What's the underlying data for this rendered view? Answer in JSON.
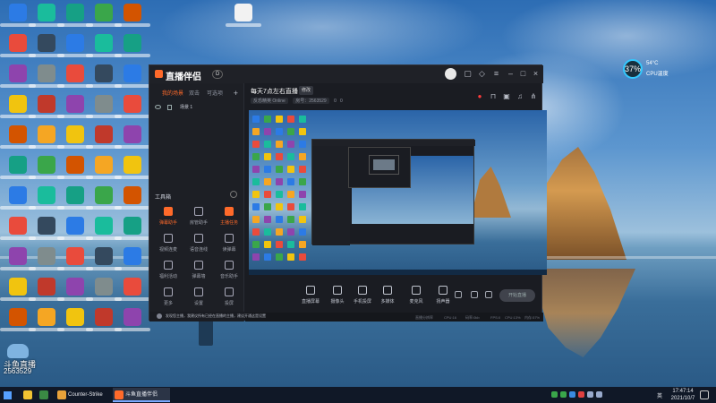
{
  "app": {
    "logo_text": "直播伴侣",
    "version_badge": "D",
    "sidebar_tabs": [
      "我的场景",
      "双击",
      "可选项"
    ],
    "scene_name": "场景 1",
    "tools_title": "工具箱",
    "tools": [
      {
        "label": "弹幕助手",
        "icon": "danmaku-icon",
        "hot": true
      },
      {
        "label": "房管助手",
        "icon": "admin-icon",
        "hot": false
      },
      {
        "label": "主播任务",
        "icon": "task-icon",
        "hot": true
      },
      {
        "label": "视频连麦",
        "icon": "video-call-icon",
        "hot": false
      },
      {
        "label": "语音连线",
        "icon": "voice-icon",
        "hot": false
      },
      {
        "label": "读弹幕",
        "icon": "read-danmaku-icon",
        "hot": false
      },
      {
        "label": "福利活动",
        "icon": "gift-icon",
        "hot": false
      },
      {
        "label": "弹幕墙",
        "icon": "wall-icon",
        "hot": false
      },
      {
        "label": "音乐助手",
        "icon": "music-icon",
        "hot": false
      },
      {
        "label": "更多",
        "icon": "more-icon",
        "hot": false
      },
      {
        "label": "设置",
        "icon": "settings-icon",
        "hot": false
      },
      {
        "label": "投屏",
        "icon": "cast-icon",
        "hot": false
      }
    ],
    "room_title": "每天7点左右直播",
    "room_tag": "修改",
    "room_meta": [
      "反恐精英 Online",
      "房号：2563529"
    ],
    "room_counts": [
      "0",
      "0"
    ],
    "controls": [
      {
        "label": "直播屏幕",
        "icon": "screen-icon"
      },
      {
        "label": "摄像头",
        "icon": "camera-icon"
      },
      {
        "label": "手机投屏",
        "icon": "phone-cast-icon"
      },
      {
        "label": "多媒体",
        "icon": "media-icon"
      },
      {
        "label": "麦克风",
        "icon": "mic-icon"
      },
      {
        "label": "扬声器",
        "icon": "speaker-icon"
      }
    ],
    "go_live_label": "开始直播",
    "notice_text": "发现您主播，我建议所有已经在直播的主播，建议开通这是设置",
    "status_items": [
      "直播分辨率",
      "CPU:16",
      "码率:0kb",
      "FPS:0",
      "CPU:13%",
      "内存:57%"
    ]
  },
  "desktop": {
    "sticker_text": "斗鱼直播",
    "room_number": "2563529",
    "widget_percent": "37%",
    "widget_temp": "54°C",
    "widget_cpu_label": "CPU温度"
  },
  "taskbar": {
    "tasks": [
      {
        "label": "Counter-Strike O...",
        "active": false,
        "color": "#e8a23a"
      },
      {
        "label": "斗鱼直播伴侣",
        "active": true,
        "color": "#ff6a2a"
      }
    ],
    "lang": "英",
    "time": "17:47:14",
    "date": "2021/10/7"
  },
  "colors": {
    "accent": "#ff6a2a",
    "record": "#ff3b3b",
    "taskbar": "#101827"
  }
}
